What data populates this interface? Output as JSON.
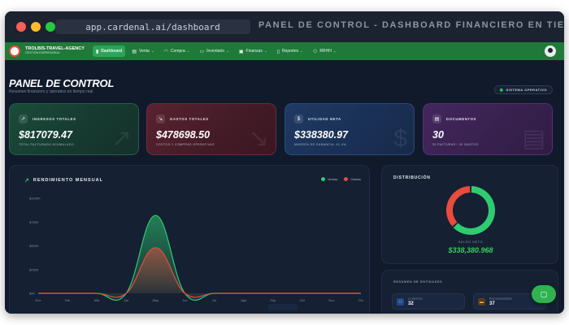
{
  "browser": {
    "url": "app.cardenal.ai/dashboard",
    "title": "PANEL DE CONTROL - DASHBOARD FINANCIERO EN TIEMPO REAL"
  },
  "brand": {
    "name": "TROLBIS-TRAVEL-AGENCY",
    "subtitle": "GESTIÓN EMPRESARIAL"
  },
  "nav": [
    {
      "label": "Dashboard",
      "icon": "bar-chart-icon",
      "glyph": "▮",
      "active": true,
      "dropdown": false
    },
    {
      "label": "Venta",
      "icon": "document-icon",
      "glyph": "▤",
      "active": false,
      "dropdown": true
    },
    {
      "label": "Compra",
      "icon": "bag-icon",
      "glyph": "◠",
      "active": false,
      "dropdown": true
    },
    {
      "label": "Inventario",
      "icon": "box-icon",
      "glyph": "▭",
      "active": false,
      "dropdown": true
    },
    {
      "label": "Finanzas",
      "icon": "wallet-icon",
      "glyph": "▣",
      "active": false,
      "dropdown": true
    },
    {
      "label": "Reportes",
      "icon": "report-icon",
      "glyph": "▯",
      "active": false,
      "dropdown": true
    },
    {
      "label": "RRHH",
      "icon": "people-icon",
      "glyph": "⚇",
      "active": false,
      "dropdown": true
    }
  ],
  "page": {
    "title": "PANEL DE CONTROL",
    "subtitle": "Resumen financiero y operativo en tiempo real",
    "status": "SISTEMA OPERATIVO"
  },
  "kpis": [
    {
      "label": "INGRESOS TOTALES",
      "value": "$817079.47",
      "sub": "TOTAL FACTURADO ACUMULADO",
      "icon": "trend-up-icon",
      "glyph": "↗"
    },
    {
      "label": "GASTOS TOTALES",
      "value": "$478698.50",
      "sub": "COSTOS Y COMPRAS OPERATIVAS",
      "icon": "trend-down-icon",
      "glyph": "↘"
    },
    {
      "label": "UTILIDAD NETA",
      "value": "$338380.97",
      "sub": "MARGEN DE GANANCIA: 41.4%",
      "icon": "dollar-icon",
      "glyph": "$"
    },
    {
      "label": "DOCUMENTOS",
      "value": "30",
      "sub": "30 FACTURAS / 30 GASTOS",
      "icon": "document-icon",
      "glyph": "▤"
    }
  ],
  "chart_panel": {
    "title": "RENDIMIENTO MENSUAL"
  },
  "chart_data": {
    "type": "area",
    "title": "RENDIMIENTO MENSUAL",
    "categories": [
      "Ene",
      "Feb",
      "Mar",
      "Abr",
      "May",
      "Jun",
      "Jul",
      "Ago",
      "Sep",
      "Oct",
      "Nov",
      "Dic"
    ],
    "series": [
      {
        "name": "Ventas",
        "color": "#2ecc71",
        "values": [
          0,
          0,
          0,
          0,
          820000,
          0,
          0,
          0,
          0,
          0,
          0,
          0
        ]
      },
      {
        "name": "Gastos",
        "color": "#e74c3c",
        "values": [
          0,
          0,
          0,
          0,
          480000,
          0,
          0,
          0,
          0,
          0,
          0,
          0
        ]
      }
    ],
    "yticks": [
      0,
      250000,
      500000,
      750000,
      1000000
    ],
    "ytick_labels": [
      "$0K",
      "$250K",
      "$500K",
      "$750K",
      "$1000K"
    ],
    "ylim": [
      0,
      1000000
    ],
    "legend": "top-right",
    "grid": false
  },
  "distribution": {
    "title": "DISTRIBUCIÓN",
    "caption": "SALDO NETO",
    "value": "$338,380.968",
    "slices": [
      {
        "name": "Ingresos",
        "value": 817079.47,
        "color": "#2ecc71"
      },
      {
        "name": "Gastos",
        "value": 478698.5,
        "color": "#e74c3c"
      }
    ]
  },
  "entities": {
    "title": "RESUMEN DE ENTIDADES",
    "items": [
      {
        "label": "CLIENTES",
        "value": "32",
        "icon": "people-icon",
        "glyph": "⚇"
      },
      {
        "label": "PROVEEDORES",
        "value": "37",
        "icon": "truck-icon",
        "glyph": "▬"
      }
    ]
  }
}
